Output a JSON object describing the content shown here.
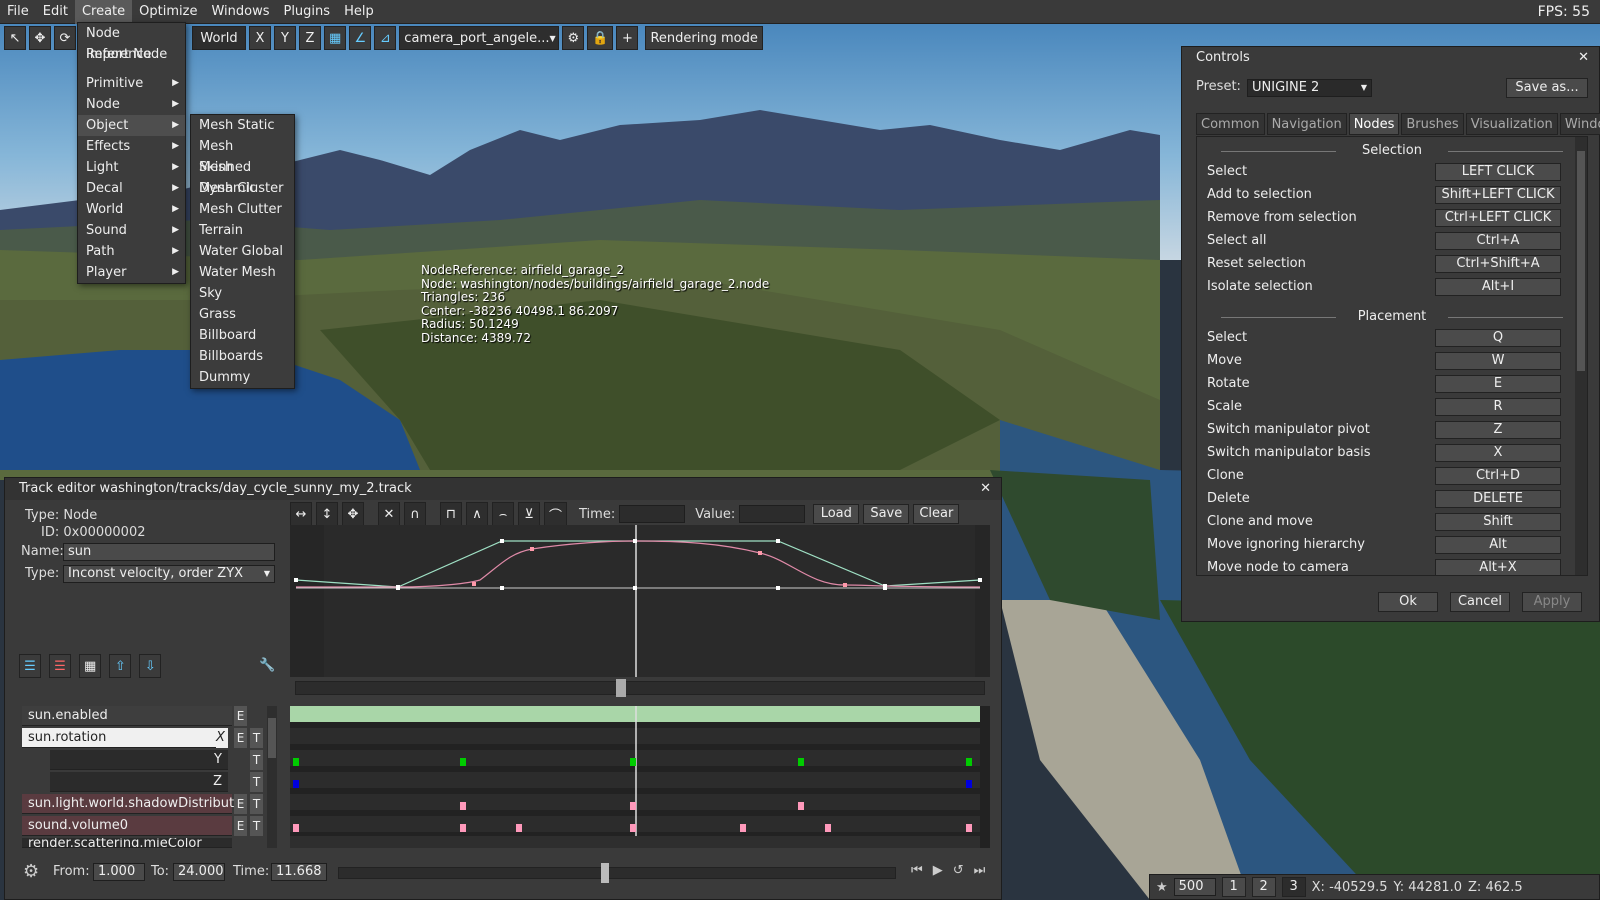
{
  "menubar": {
    "items": [
      "File",
      "Edit",
      "Create",
      "Optimize",
      "Windows",
      "Plugins",
      "Help"
    ],
    "fps": "FPS: 55"
  },
  "toolbar": {
    "coord_space": "World",
    "axes": [
      "X",
      "Y",
      "Z"
    ],
    "camera": "camera_port_angele...",
    "rendering": "Rendering mode"
  },
  "create_menu": {
    "items": [
      "Node Reference",
      "Import Node",
      "",
      "Primitive",
      "Node",
      "Object",
      "Effects",
      "Light",
      "Decal",
      "World",
      "Sound",
      "Path",
      "Player"
    ],
    "with_submenu": [
      "Primitive",
      "Node",
      "Object",
      "Effects",
      "Light",
      "Decal",
      "World",
      "Sound",
      "Path",
      "Player"
    ]
  },
  "object_menu": {
    "items": [
      "Mesh Static",
      "Mesh Skinned",
      "Mesh Dynamic",
      "Mesh Cluster",
      "Mesh Clutter",
      "Terrain",
      "Water Global",
      "Water Mesh",
      "Sky",
      "Grass",
      "Billboard",
      "Billboards",
      "Dummy"
    ]
  },
  "node_info": [
    "NodeReference: airfield_garage_2",
    "Node: washington/nodes/buildings/airfield_garage_2.node",
    "Triangles: 236",
    "Center: -38236 40498.1 86.2097",
    "Radius: 50.1249",
    "Distance: 4389.72"
  ],
  "controls": {
    "title": "Controls",
    "preset_label": "Preset:",
    "preset_value": "UNIGINE 2",
    "save_as": "Save as...",
    "tabs": [
      "Common",
      "Navigation",
      "Nodes",
      "Brushes",
      "Visualization",
      "Windows"
    ],
    "active_tab": "Nodes",
    "sections": [
      {
        "title": "Selection",
        "rows": [
          [
            "Select",
            "LEFT CLICK"
          ],
          [
            "Add to selection",
            "Shift+LEFT CLICK"
          ],
          [
            "Remove from selection",
            "Ctrl+LEFT CLICK"
          ],
          [
            "Select all",
            "Ctrl+A"
          ],
          [
            "Reset selection",
            "Ctrl+Shift+A"
          ],
          [
            "Isolate selection",
            "Alt+I"
          ]
        ]
      },
      {
        "title": "Placement",
        "rows": [
          [
            "Select",
            "Q"
          ],
          [
            "Move",
            "W"
          ],
          [
            "Rotate",
            "E"
          ],
          [
            "Scale",
            "R"
          ],
          [
            "Switch manipulator pivot",
            "Z"
          ],
          [
            "Switch manipulator basis",
            "X"
          ],
          [
            "Clone",
            "Ctrl+D"
          ],
          [
            "Delete",
            "DELETE"
          ],
          [
            "Clone and move",
            "Shift"
          ],
          [
            "Move ignoring hierarchy",
            "Alt"
          ],
          [
            "Move node to camera",
            "Alt+X"
          ]
        ]
      }
    ],
    "ok": "Ok",
    "cancel": "Cancel",
    "apply": "Apply"
  },
  "track": {
    "title": "Track editor washington/tracks/day_cycle_sunny_my_2.track",
    "type_line": "Type: Node",
    "id_line": "ID: 0x00000002",
    "name_label": "Name:",
    "name_value": "sun",
    "type_label": "Type:",
    "type_value": "Inconst velocity, order ZYX",
    "time_label": "Time:",
    "value_label": "Value:",
    "load": "Load",
    "save": "Save",
    "clear": "Clear",
    "tracks": [
      "sun.enabled",
      "sun.rotation",
      "Y",
      "Z",
      "sun.light.world.shadowDistribute",
      "sound.volume0",
      "render.scattering.mieColor"
    ],
    "x_mark": "X",
    "e": "E",
    "t": "T",
    "from_label": "From:",
    "from": "1.000",
    "to_label": "To:",
    "to": "24.000",
    "time": "11.668"
  },
  "status": {
    "speed": "500",
    "b1": "1",
    "b2": "2",
    "b3": "3",
    "x": "X: -40529.5",
    "y": "Y: 44281.0",
    "z": "Z: 462.5"
  }
}
